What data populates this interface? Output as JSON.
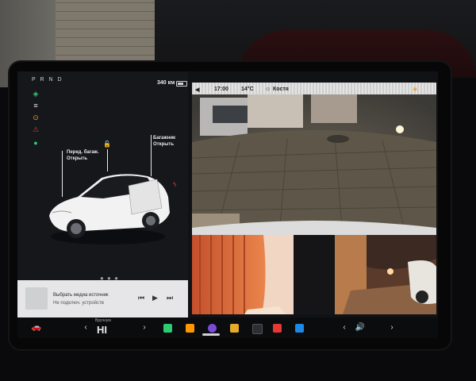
{
  "status": {
    "gear": "P R N D",
    "range": "340 км"
  },
  "car_labels": {
    "front_trunk": "Перед. багаж. Открыть",
    "rear_trunk": "Багажник Открыть"
  },
  "media": {
    "line1": "Выбрать медиа источник",
    "line2": "Не подключ. устройств"
  },
  "camera_header": {
    "time": "17:00",
    "temp": "14°C",
    "user": "Костя"
  },
  "climate": {
    "mode": "Вручную",
    "value": "HI"
  },
  "colors": {
    "accent_green": "#2ecc71",
    "accent_red": "#e53935",
    "accent_orange": "#ff9800",
    "media_bg": "#e6e6e8"
  },
  "icons": [
    "car-icon",
    "phone-icon",
    "music-icon",
    "bluetooth-icon",
    "volume-icon",
    "calendar-icon",
    "camera-icon"
  ]
}
